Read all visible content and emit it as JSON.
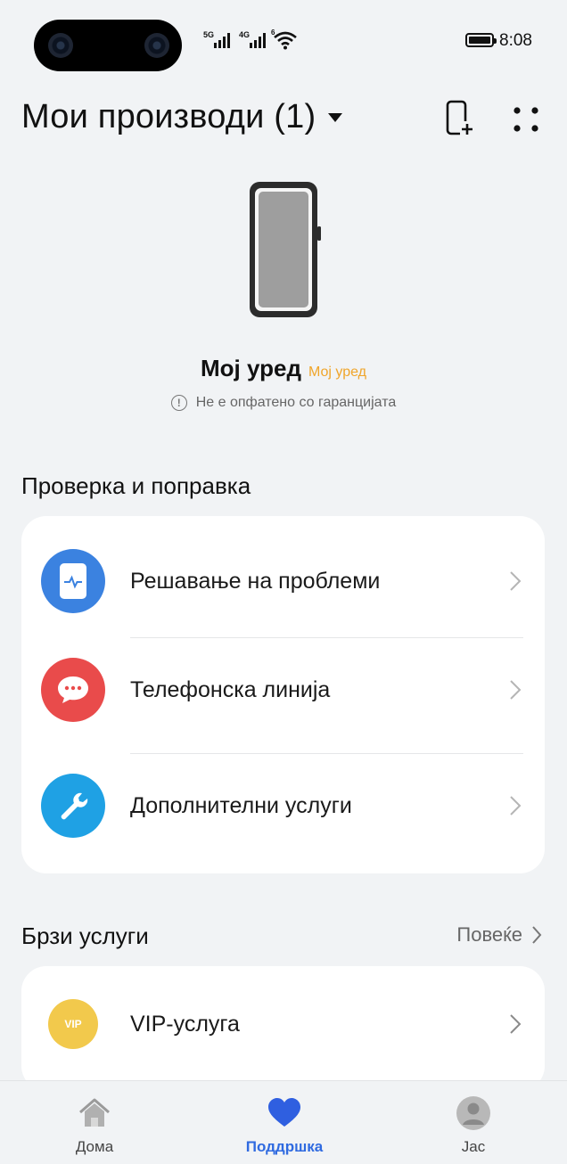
{
  "status_bar": {
    "sim1_label": "5G",
    "sim2_label": "4G",
    "sim2_sub": "6",
    "time": "8:08"
  },
  "header": {
    "title": "Мои производи (1)",
    "add_icon": "add-device-icon",
    "more_icon": "more-grid-icon"
  },
  "device": {
    "name": "Мој уред",
    "tag": "Мој уред",
    "warranty_icon": "info-icon",
    "warranty_text": "Не е опфатено со гаранцијата",
    "tag_color": "#f0a52a"
  },
  "check_repair": {
    "title": "Проверка и поправка",
    "items": [
      {
        "label": "Решавање на проблеми",
        "icon": "phone-diagnostic-icon",
        "color": "#3b82e0"
      },
      {
        "label": "Телефонска линија",
        "icon": "chat-bubble-icon",
        "color": "#e94b4b"
      },
      {
        "label": "Дополнителни услуги",
        "icon": "wrench-icon",
        "color": "#1fa1e4"
      }
    ]
  },
  "quick_services": {
    "title": "Брзи услуги",
    "more_label": "Повеќе",
    "items": [
      {
        "label": "VIP-услуга",
        "badge": "VIP",
        "icon": "vip-badge-icon",
        "color": "#f2c94c"
      }
    ]
  },
  "bottom_nav": {
    "items": [
      {
        "label": "Дома",
        "icon": "home-icon",
        "active": false
      },
      {
        "label": "Поддршка",
        "icon": "heart-icon",
        "active": true
      },
      {
        "label": "Јас",
        "icon": "profile-icon",
        "active": false
      }
    ],
    "active_color": "#2f6ae0"
  }
}
